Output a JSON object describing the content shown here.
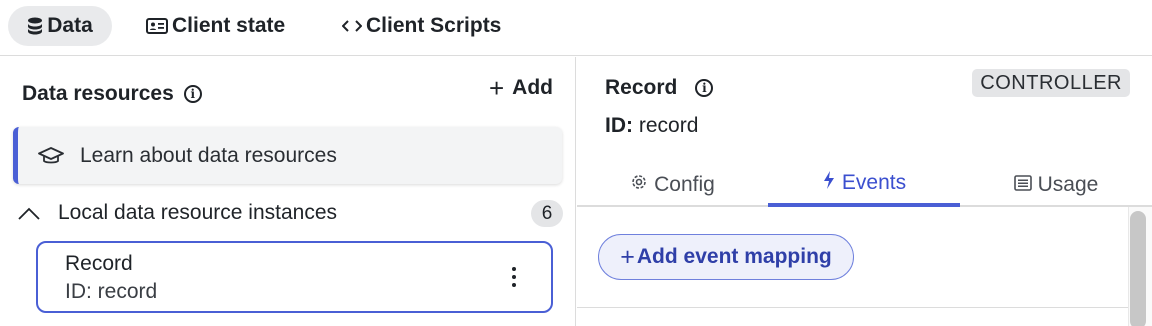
{
  "top_tabs": [
    {
      "label": "Data",
      "icon": "database-icon",
      "active": true
    },
    {
      "label": "Client state",
      "icon": "id-card-icon",
      "active": false
    },
    {
      "label": "Client Scripts",
      "icon": "code-icon",
      "active": false
    }
  ],
  "left": {
    "title": "Data resources",
    "add_label": "Add",
    "learn_label": "Learn about data resources",
    "group_label": "Local data resource instances",
    "group_count": "6",
    "record": {
      "name": "Record",
      "id_text": "ID: record"
    }
  },
  "right": {
    "title": "Record",
    "badge": "CONTROLLER",
    "id_label": "ID:",
    "id_value": "record",
    "tabs": [
      {
        "label": "Config",
        "icon": "gear-icon"
      },
      {
        "label": "Events",
        "icon": "bolt-icon"
      },
      {
        "label": "Usage",
        "icon": "list-icon"
      }
    ],
    "active_tab": "Events",
    "add_mapping_label": "Add event mapping"
  },
  "colors": {
    "accent": "#4a5fd5",
    "accent_text": "#3b4fcf"
  }
}
